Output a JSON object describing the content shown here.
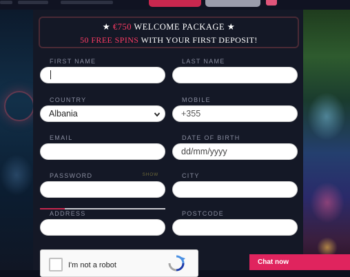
{
  "banner": {
    "line1_star_left": "★",
    "line1_amount": "€750",
    "line1_text": "WELCOME PACKAGE",
    "line1_star_right": "★",
    "line2_highlight": "50 FREE SPINS",
    "line2_text": "WITH YOUR FIRST DEPOSIT!"
  },
  "form": {
    "first_name": {
      "label": "FIRST NAME",
      "value": "",
      "placeholder": ""
    },
    "last_name": {
      "label": "LAST NAME",
      "value": "",
      "placeholder": ""
    },
    "country": {
      "label": "COUNTRY",
      "selected": "Albania"
    },
    "mobile": {
      "label": "MOBILE",
      "value": "+355"
    },
    "email": {
      "label": "EMAIL",
      "value": ""
    },
    "dob": {
      "label": "DATE OF BIRTH",
      "placeholder": "dd/mm/yyyy"
    },
    "password": {
      "label": "PASSWORD",
      "show_label": "SHOW",
      "value": "",
      "strength": 0.2
    },
    "city": {
      "label": "CITY",
      "value": ""
    },
    "address": {
      "label": "ADDRESS",
      "value": ""
    },
    "postcode": {
      "label": "POSTCODE",
      "value": ""
    }
  },
  "recaptcha": {
    "label": "I'm not a robot",
    "icon": "recaptcha-logo-icon"
  },
  "chat": {
    "label": "Chat now"
  },
  "colors": {
    "accent": "#e0245e",
    "highlight": "#ff3b64",
    "panel": "#141826"
  }
}
